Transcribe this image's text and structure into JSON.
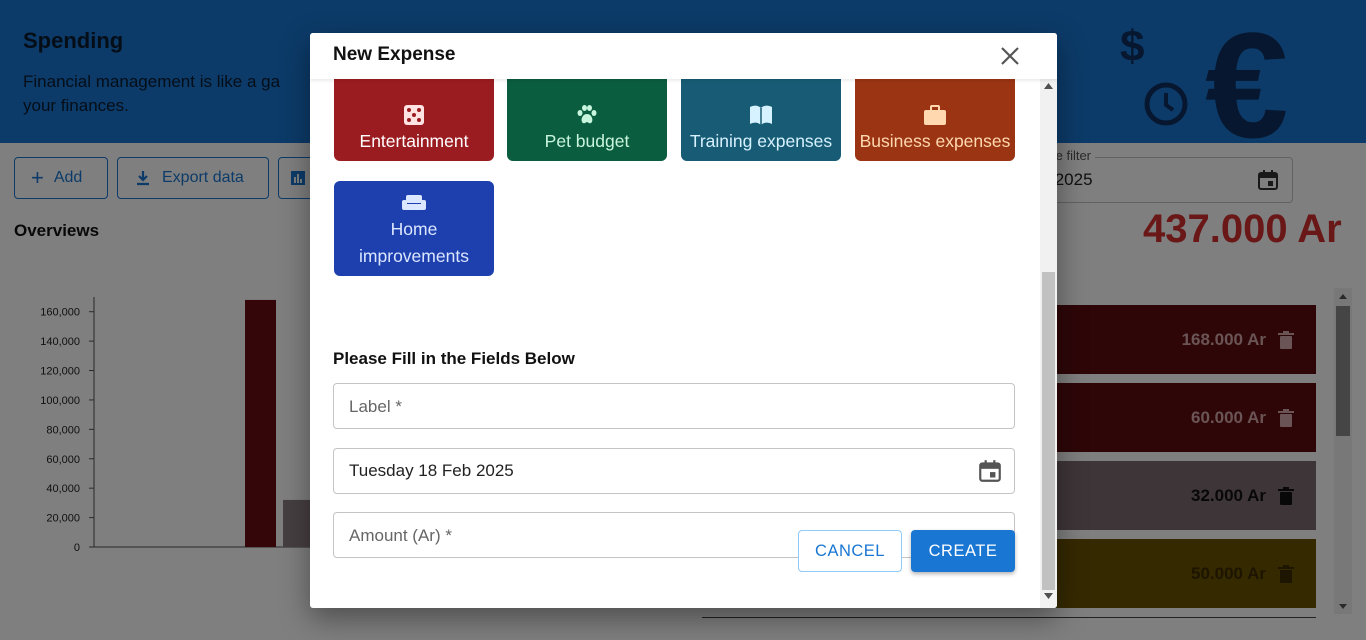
{
  "page": {
    "title": "Spending",
    "subtitle_line1": "Financial management is like a ga",
    "subtitle_line2": "your finances.",
    "toolbar": {
      "add_label": "Add",
      "export_label": "Export data"
    },
    "overviews_label": "Overviews",
    "date_filter": {
      "label": "te filter",
      "value": "/2025"
    },
    "total": "437.000 Ar",
    "expense_cards": [
      {
        "amount": "168.000 Ar",
        "color": "#5c0d10",
        "text_color": "#d7a9aa"
      },
      {
        "amount": "60.000 Ar",
        "color": "#5c0d10",
        "text_color": "#d7a9aa"
      },
      {
        "amount": "32.000 Ar",
        "color": "#7d6a70",
        "text_color": "#111111"
      },
      {
        "amount": "50.000 Ar",
        "color": "#6b5200",
        "text_color": "#3a2a00"
      }
    ]
  },
  "chart_data": {
    "type": "bar",
    "y_ticks": [
      "160,000",
      "140,000",
      "120,000",
      "100,000",
      "80,000",
      "60,000",
      "40,000",
      "20,000",
      "0"
    ],
    "ylim": [
      0,
      170000
    ],
    "values": [
      168000,
      32000
    ],
    "colors": [
      "#6b0d12",
      "#8d7f84"
    ]
  },
  "modal": {
    "title": "New Expense",
    "categories": [
      {
        "label": "Entertainment",
        "icon": "dice-icon",
        "bg": "#9b1c20",
        "fg": "#ffffff"
      },
      {
        "label": "Pet budget",
        "icon": "paw-icon",
        "bg": "#0b5d40",
        "fg": "#c8f5dd"
      },
      {
        "label": "Training expenses",
        "icon": "book-icon",
        "bg": "#175c74",
        "fg": "#d6f1ff"
      },
      {
        "label": "Business expenses",
        "icon": "briefcase-icon",
        "bg": "#9a3412",
        "fg": "#ffd8b0"
      },
      {
        "label": "Home improvements",
        "icon": "sofa-icon",
        "bg": "#1e40af",
        "fg": "#dbe6ff"
      }
    ],
    "form_title": "Please Fill in the Fields Below",
    "fields": {
      "label_placeholder": "Label *",
      "date_value": "Tuesday 18 Feb 2025",
      "amount_placeholder": "Amount (Ar) *"
    },
    "cancel_label": "CANCEL",
    "create_label": "CREATE"
  }
}
